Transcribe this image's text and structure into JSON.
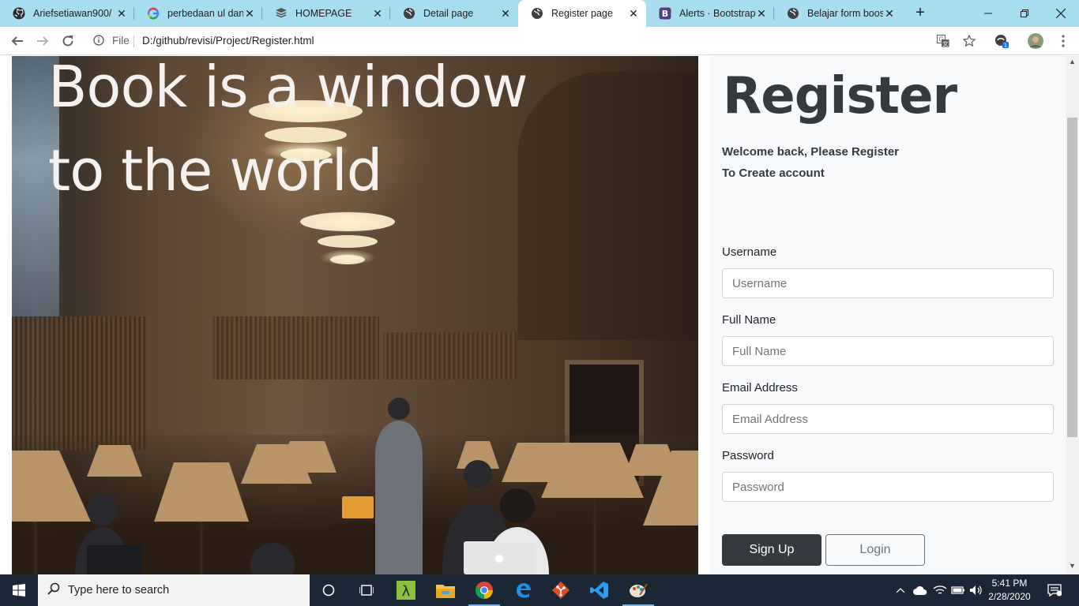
{
  "browser": {
    "tabs": [
      {
        "title": "Ariefsetiawan900/",
        "icon": "github-icon",
        "active": false
      },
      {
        "title": "perbedaan ul dan",
        "icon": "google-icon",
        "active": false
      },
      {
        "title": "HOMEPAGE",
        "icon": "book-icon",
        "active": false
      },
      {
        "title": "Detail page",
        "icon": "globe-icon",
        "active": false
      },
      {
        "title": "Register page",
        "icon": "globe-icon",
        "active": true
      },
      {
        "title": "Alerts · Bootstrap",
        "icon": "bootstrap-icon",
        "active": false
      },
      {
        "title": "Belajar form boost",
        "icon": "globe-icon",
        "active": false
      }
    ],
    "new_tab_label": "+",
    "address": {
      "scheme_label": "File",
      "url": "D:/github/revisi/Project/Register.html"
    }
  },
  "page": {
    "hero_line1": "Book is a window",
    "hero_line2": "to the world",
    "register_title": "Register",
    "welcome_line1": "Welcome back, Please Register",
    "welcome_line2": "To Create account",
    "fields": {
      "username": {
        "label": "Username",
        "placeholder": "Username",
        "value": ""
      },
      "fullname": {
        "label": "Full Name",
        "placeholder": "Full Name",
        "value": ""
      },
      "email": {
        "label": "Email Address",
        "placeholder": "Email Address",
        "value": ""
      },
      "password": {
        "label": "Password",
        "placeholder": "Password",
        "value": ""
      }
    },
    "signup_label": "Sign Up",
    "login_label": "Login",
    "colors": {
      "dark": "#343a40",
      "panel_bg": "#f8f9fa",
      "secondary": "#6c757d"
    }
  },
  "taskbar": {
    "search_placeholder": "Type here to search",
    "time": "5:41 PM",
    "date": "2/28/2020",
    "apps": [
      "cortana-icon",
      "task-view-icon",
      "lambda-app-icon",
      "file-explorer-icon",
      "chrome-icon",
      "edge-icon",
      "git-icon",
      "vscode-icon",
      "paint-icon"
    ]
  }
}
